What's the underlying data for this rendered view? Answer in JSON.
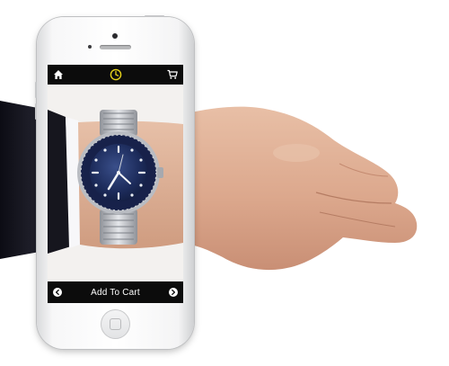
{
  "app": {
    "top_bar": {
      "home_icon": "home-icon",
      "logo_icon": "watch-clock-logo-icon",
      "cart_icon": "shopping-cart-icon",
      "logo_color": "#e6d21a"
    },
    "bottom_bar": {
      "add_to_cart_label": "Add To Cart",
      "prev_icon": "arrow-left-circle-icon",
      "next_icon": "arrow-right-circle-icon"
    },
    "product_view": {
      "dial_color": "#1d2c5c",
      "bezel_color": "#17214a",
      "bracelet_color": "#b9bcc2"
    }
  },
  "device": {
    "type": "smartphone",
    "body_color": "#f4f4f5"
  }
}
